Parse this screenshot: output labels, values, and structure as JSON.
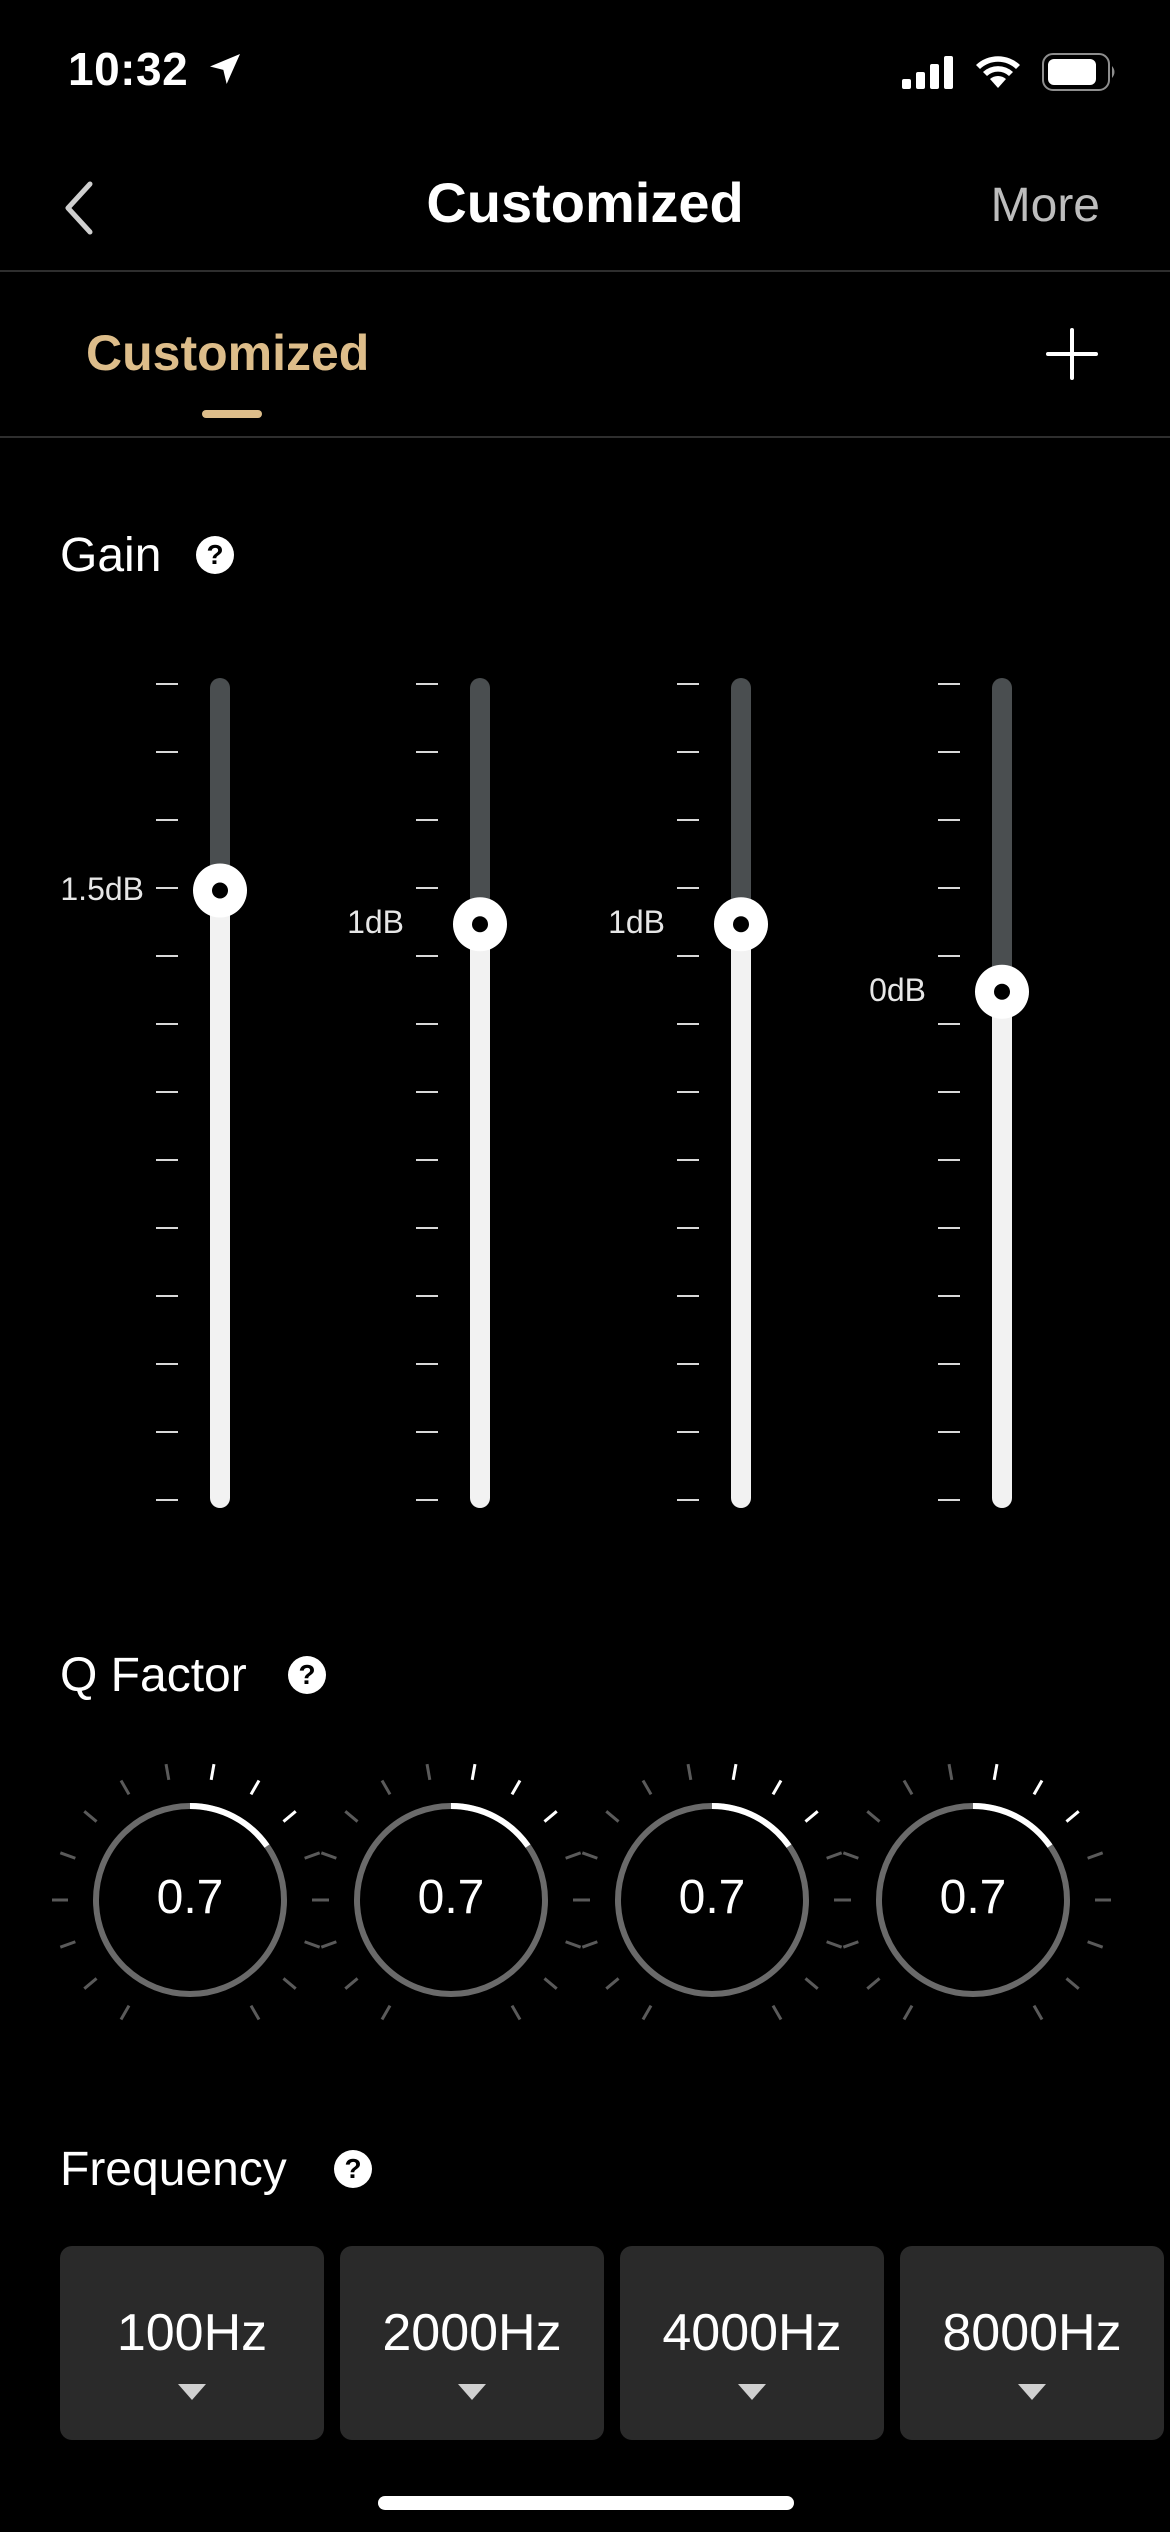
{
  "status_bar": {
    "time": "10:32",
    "icons": [
      "location-arrow-icon",
      "signal-icon",
      "wifi-icon",
      "battery-icon"
    ]
  },
  "nav": {
    "title": "Customized",
    "more_label": "More"
  },
  "tabs": [
    {
      "label": "Customized",
      "active": true
    }
  ],
  "gain": {
    "title": "Gain",
    "bands": [
      {
        "label": "1.5dB",
        "value_db": 1.5
      },
      {
        "label": "1dB",
        "value_db": 1
      },
      {
        "label": "1dB",
        "value_db": 1
      },
      {
        "label": "0dB",
        "value_db": 0
      }
    ]
  },
  "q_factor": {
    "title": "Q Factor",
    "knobs": [
      {
        "value": "0.7"
      },
      {
        "value": "0.7"
      },
      {
        "value": "0.7"
      },
      {
        "value": "0.7"
      }
    ]
  },
  "frequency": {
    "title": "Frequency",
    "options": [
      {
        "value": "100Hz"
      },
      {
        "value": "2000Hz"
      },
      {
        "value": "4000Hz"
      },
      {
        "value": "8000Hz"
      }
    ]
  },
  "colors": {
    "accent": "#ddbd8a",
    "background": "#000000",
    "track": "#4a4e50",
    "fill": "#f2f2f2"
  }
}
